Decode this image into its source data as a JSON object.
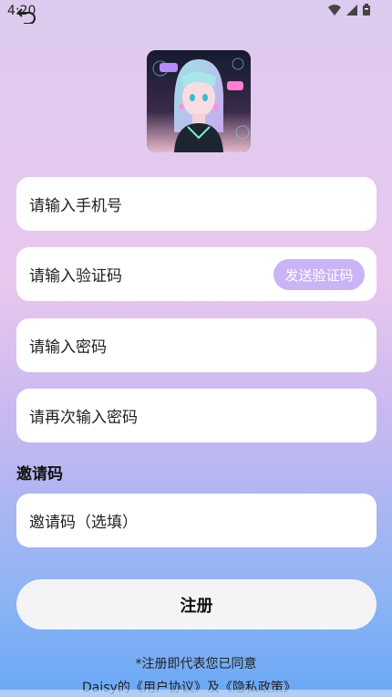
{
  "status_bar": {
    "time": "4:20"
  },
  "avatar": {
    "alt": "anime girl avatar"
  },
  "form": {
    "phone_placeholder": "请输入手机号",
    "code_placeholder": "请输入验证码",
    "send_code_label": "发送验证码",
    "password_placeholder": "请输入密码",
    "confirm_password_placeholder": "请再次输入密码",
    "invite_section_label": "邀请码",
    "invite_placeholder": "邀请码（选填）",
    "register_label": "注册"
  },
  "agreement": {
    "line1": "*注册即代表您已同意",
    "app_name": "Daisy",
    "of": "的",
    "user_agreement": "《用户协议》",
    "and": "及",
    "privacy_policy": "《隐私政策》"
  },
  "colors": {
    "accent": "#c9b5f5",
    "bg_top": "#dccbee",
    "bg_bottom": "#6aa8f6"
  }
}
